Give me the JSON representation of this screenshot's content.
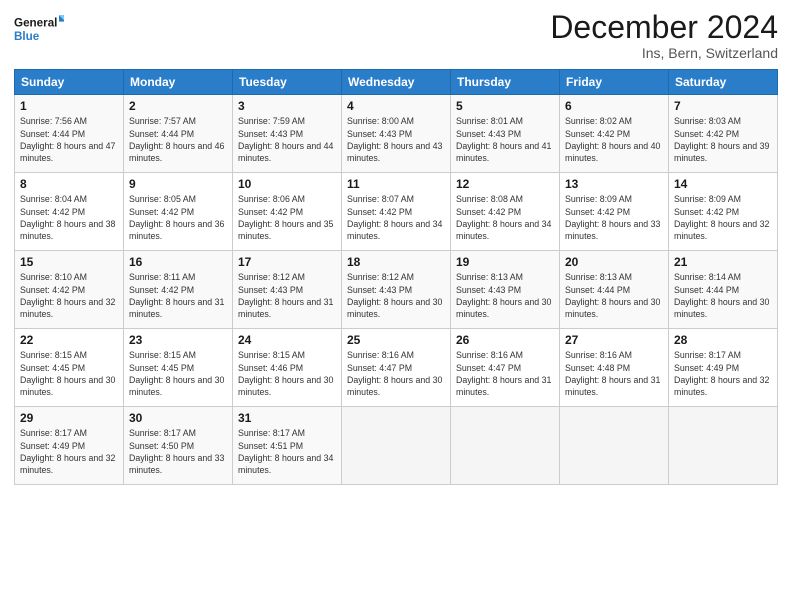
{
  "logo": {
    "text_general": "General",
    "text_blue": "Blue"
  },
  "header": {
    "title": "December 2024",
    "subtitle": "Ins, Bern, Switzerland"
  },
  "weekdays": [
    "Sunday",
    "Monday",
    "Tuesday",
    "Wednesday",
    "Thursday",
    "Friday",
    "Saturday"
  ],
  "weeks": [
    [
      {
        "day": "1",
        "sunrise": "7:56 AM",
        "sunset": "4:44 PM",
        "daylight": "8 hours and 47 minutes."
      },
      {
        "day": "2",
        "sunrise": "7:57 AM",
        "sunset": "4:44 PM",
        "daylight": "8 hours and 46 minutes."
      },
      {
        "day": "3",
        "sunrise": "7:59 AM",
        "sunset": "4:43 PM",
        "daylight": "8 hours and 44 minutes."
      },
      {
        "day": "4",
        "sunrise": "8:00 AM",
        "sunset": "4:43 PM",
        "daylight": "8 hours and 43 minutes."
      },
      {
        "day": "5",
        "sunrise": "8:01 AM",
        "sunset": "4:43 PM",
        "daylight": "8 hours and 41 minutes."
      },
      {
        "day": "6",
        "sunrise": "8:02 AM",
        "sunset": "4:42 PM",
        "daylight": "8 hours and 40 minutes."
      },
      {
        "day": "7",
        "sunrise": "8:03 AM",
        "sunset": "4:42 PM",
        "daylight": "8 hours and 39 minutes."
      }
    ],
    [
      {
        "day": "8",
        "sunrise": "8:04 AM",
        "sunset": "4:42 PM",
        "daylight": "8 hours and 38 minutes."
      },
      {
        "day": "9",
        "sunrise": "8:05 AM",
        "sunset": "4:42 PM",
        "daylight": "8 hours and 36 minutes."
      },
      {
        "day": "10",
        "sunrise": "8:06 AM",
        "sunset": "4:42 PM",
        "daylight": "8 hours and 35 minutes."
      },
      {
        "day": "11",
        "sunrise": "8:07 AM",
        "sunset": "4:42 PM",
        "daylight": "8 hours and 34 minutes."
      },
      {
        "day": "12",
        "sunrise": "8:08 AM",
        "sunset": "4:42 PM",
        "daylight": "8 hours and 34 minutes."
      },
      {
        "day": "13",
        "sunrise": "8:09 AM",
        "sunset": "4:42 PM",
        "daylight": "8 hours and 33 minutes."
      },
      {
        "day": "14",
        "sunrise": "8:09 AM",
        "sunset": "4:42 PM",
        "daylight": "8 hours and 32 minutes."
      }
    ],
    [
      {
        "day": "15",
        "sunrise": "8:10 AM",
        "sunset": "4:42 PM",
        "daylight": "8 hours and 32 minutes."
      },
      {
        "day": "16",
        "sunrise": "8:11 AM",
        "sunset": "4:42 PM",
        "daylight": "8 hours and 31 minutes."
      },
      {
        "day": "17",
        "sunrise": "8:12 AM",
        "sunset": "4:43 PM",
        "daylight": "8 hours and 31 minutes."
      },
      {
        "day": "18",
        "sunrise": "8:12 AM",
        "sunset": "4:43 PM",
        "daylight": "8 hours and 30 minutes."
      },
      {
        "day": "19",
        "sunrise": "8:13 AM",
        "sunset": "4:43 PM",
        "daylight": "8 hours and 30 minutes."
      },
      {
        "day": "20",
        "sunrise": "8:13 AM",
        "sunset": "4:44 PM",
        "daylight": "8 hours and 30 minutes."
      },
      {
        "day": "21",
        "sunrise": "8:14 AM",
        "sunset": "4:44 PM",
        "daylight": "8 hours and 30 minutes."
      }
    ],
    [
      {
        "day": "22",
        "sunrise": "8:15 AM",
        "sunset": "4:45 PM",
        "daylight": "8 hours and 30 minutes."
      },
      {
        "day": "23",
        "sunrise": "8:15 AM",
        "sunset": "4:45 PM",
        "daylight": "8 hours and 30 minutes."
      },
      {
        "day": "24",
        "sunrise": "8:15 AM",
        "sunset": "4:46 PM",
        "daylight": "8 hours and 30 minutes."
      },
      {
        "day": "25",
        "sunrise": "8:16 AM",
        "sunset": "4:47 PM",
        "daylight": "8 hours and 30 minutes."
      },
      {
        "day": "26",
        "sunrise": "8:16 AM",
        "sunset": "4:47 PM",
        "daylight": "8 hours and 31 minutes."
      },
      {
        "day": "27",
        "sunrise": "8:16 AM",
        "sunset": "4:48 PM",
        "daylight": "8 hours and 31 minutes."
      },
      {
        "day": "28",
        "sunrise": "8:17 AM",
        "sunset": "4:49 PM",
        "daylight": "8 hours and 32 minutes."
      }
    ],
    [
      {
        "day": "29",
        "sunrise": "8:17 AM",
        "sunset": "4:49 PM",
        "daylight": "8 hours and 32 minutes."
      },
      {
        "day": "30",
        "sunrise": "8:17 AM",
        "sunset": "4:50 PM",
        "daylight": "8 hours and 33 minutes."
      },
      {
        "day": "31",
        "sunrise": "8:17 AM",
        "sunset": "4:51 PM",
        "daylight": "8 hours and 34 minutes."
      },
      null,
      null,
      null,
      null
    ]
  ]
}
